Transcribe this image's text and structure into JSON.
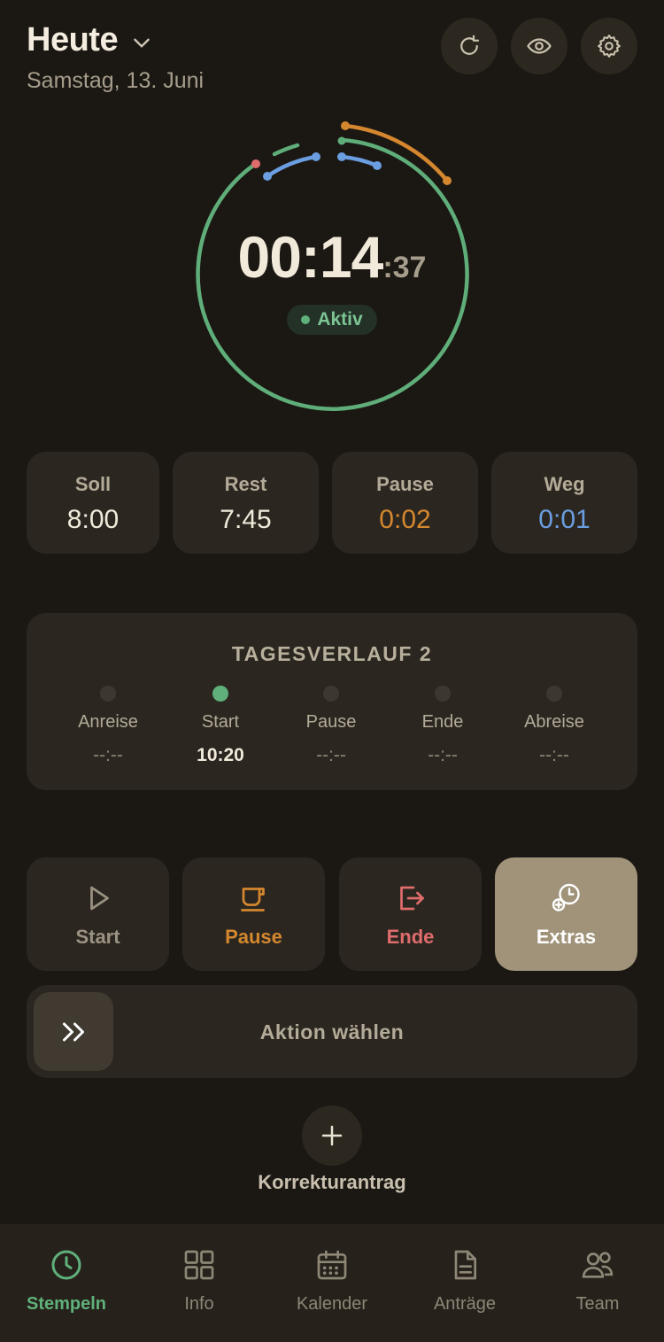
{
  "header": {
    "title": "Heute",
    "date": "Samstag, 13. Juni"
  },
  "timer": {
    "main": "00:14",
    "seconds": ":37",
    "status": "Aktiv"
  },
  "stats": [
    {
      "label": "Soll",
      "value": "8:00",
      "color": "#f1eadb"
    },
    {
      "label": "Rest",
      "value": "7:45",
      "color": "#f1eadb"
    },
    {
      "label": "Pause",
      "value": "0:02",
      "color": "#d4872e"
    },
    {
      "label": "Weg",
      "value": "0:01",
      "color": "#6a9ee0"
    }
  ],
  "verlauf": {
    "title": "TAGESVERLAUF 2",
    "steps": [
      {
        "label": "Anreise",
        "time": "--:--"
      },
      {
        "label": "Start",
        "time": "10:20"
      },
      {
        "label": "Pause",
        "time": "--:--"
      },
      {
        "label": "Ende",
        "time": "--:--"
      },
      {
        "label": "Abreise",
        "time": "--:--"
      }
    ]
  },
  "actions": [
    {
      "label": "Start",
      "icon": "play-icon",
      "color": "#9b9282"
    },
    {
      "label": "Pause",
      "icon": "coffee-icon",
      "color": "#d4872e"
    },
    {
      "label": "Ende",
      "icon": "logout-icon",
      "color": "#e06c6c"
    },
    {
      "label": "Extras",
      "icon": "clock-plus-icon",
      "color": "#ffffff"
    }
  ],
  "slider": {
    "label": "Aktion wählen"
  },
  "korrektur": {
    "label": "Korrekturantrag"
  },
  "nav": [
    {
      "label": "Stempeln",
      "icon": "clock-icon",
      "active": true
    },
    {
      "label": "Info",
      "icon": "grid-icon",
      "active": false
    },
    {
      "label": "Kalender",
      "icon": "calendar-icon",
      "active": false
    },
    {
      "label": "Anträge",
      "icon": "document-icon",
      "active": false
    },
    {
      "label": "Team",
      "icon": "team-icon",
      "active": false
    }
  ],
  "colors": {
    "accent": "#5fb07a",
    "pause": "#d4872e",
    "away": "#6a9ee0",
    "end": "#e06c6c",
    "background": "#1b1813"
  }
}
